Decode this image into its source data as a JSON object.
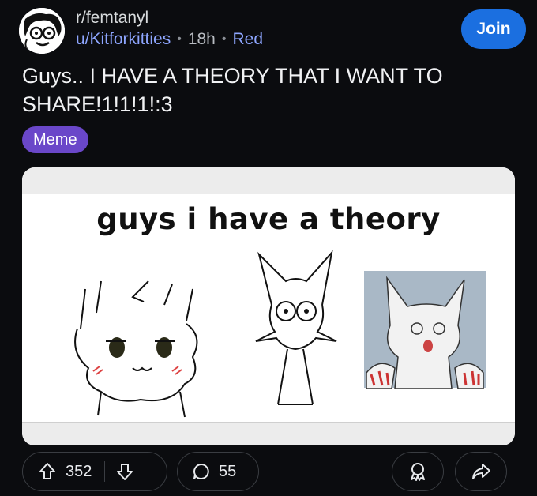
{
  "post": {
    "subreddit": "r/femtanyl",
    "username": "u/Kitforkitties",
    "separator": "•",
    "time": "18h",
    "inline_flair": "Red",
    "join_label": "Join",
    "title": "Guys.. I HAVE A THEORY THAT I WANT TO SHARE!1!1!1!:3",
    "flair": "Meme"
  },
  "media": {
    "meme_caption": "guys i have a theory"
  },
  "actions": {
    "upvotes": "352",
    "comments": "55"
  },
  "colors": {
    "join": "#1b6fe0",
    "flair": "#6a47c9",
    "link": "#8ea6ff"
  }
}
